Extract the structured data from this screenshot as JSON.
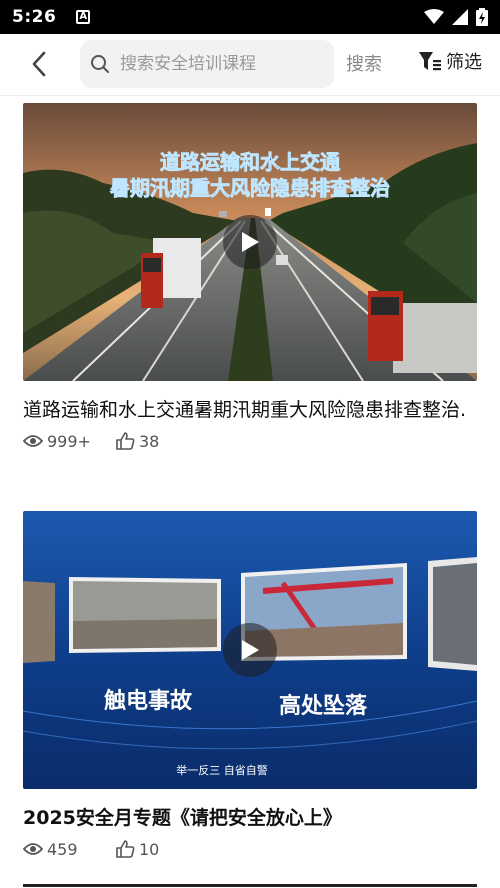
{
  "status_bar": {
    "time": "5:26",
    "notification_icon": "A"
  },
  "header": {
    "search_placeholder": "搜索安全培训课程",
    "search_label": "搜索",
    "filter_label": "筛选"
  },
  "videos": [
    {
      "title": "道路运输和水上交通暑期汛期重大风险隐患排查整治.",
      "thumb_caption_line1": "道路运输和水上交通",
      "thumb_caption_line2": "暑期汛期重大风险隐患排查整治",
      "views": "999+",
      "likes": "38"
    },
    {
      "title": "2025安全月专题《请把安全放心上》",
      "thumb_label_left": "触电事故",
      "thumb_label_right": "高处坠落",
      "thumb_footer": "举一反三 自省自警",
      "views": "459",
      "likes": "10"
    }
  ],
  "colors": {
    "accent": "#1a3a8a",
    "caption_blue": "#1e4fd8"
  }
}
